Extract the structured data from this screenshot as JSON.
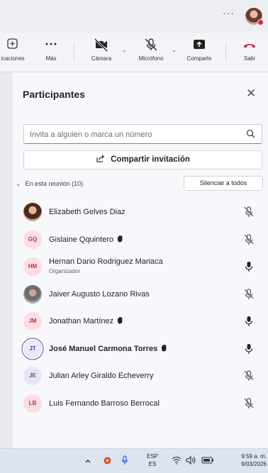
{
  "titlebar": {
    "more_glyph": "···"
  },
  "toolbar": {
    "items": [
      {
        "label": "icaciones",
        "icon": "plus-square-icon"
      },
      {
        "label": "Más",
        "icon": "more-dots-icon"
      },
      {
        "label": "Cámara",
        "icon": "camera-off-icon"
      },
      {
        "label": "Micrófono",
        "icon": "mic-off-icon"
      },
      {
        "label": "Comparte",
        "icon": "share-tray-icon"
      },
      {
        "label": "Salir",
        "icon": "hang-up-icon"
      }
    ]
  },
  "panel": {
    "title": "Participantes",
    "search_placeholder": "Invita a alguien o marca un número",
    "share_label": "Compartir invitación",
    "section_label": "En esta reunión (10)",
    "mute_all_label": "Silenciar a todos"
  },
  "participants": [
    {
      "name": "Elizabeth Gelves Diaz",
      "initials": "",
      "role": "",
      "mic": "off"
    },
    {
      "name": "Gislaine Qquintero",
      "initials": "GQ",
      "role": "",
      "mic": "off",
      "hand": true
    },
    {
      "name": "Hernan Dario Rodriguez Mariaca",
      "initials": "HM",
      "role": "Organizador",
      "mic": "on"
    },
    {
      "name": "Jaiver Augusto Lozano Rivas",
      "initials": "",
      "role": "",
      "mic": "off"
    },
    {
      "name": "Jonathan Martínez",
      "initials": "JM",
      "role": "",
      "mic": "on",
      "hand": true
    },
    {
      "name": "José Manuel Carmona Torres",
      "initials": "JT",
      "role": "",
      "mic": "on",
      "hand": true,
      "speaking": true
    },
    {
      "name": "Julian Arley Giraldo Echeverry",
      "initials": "JE",
      "role": "",
      "mic": "off"
    },
    {
      "name": "Luis Fernando Barroso Berrocal",
      "initials": "LB",
      "role": "",
      "mic": "off"
    }
  ],
  "taskbar": {
    "lang_top": "ESP",
    "lang_bottom": "ES",
    "time": "9:59 a. m.",
    "date": "9/03/2026"
  },
  "colors": {
    "accent": "#5b5fc7",
    "hangup": "#c4314b",
    "panel_bg": "#f7f8fb"
  }
}
